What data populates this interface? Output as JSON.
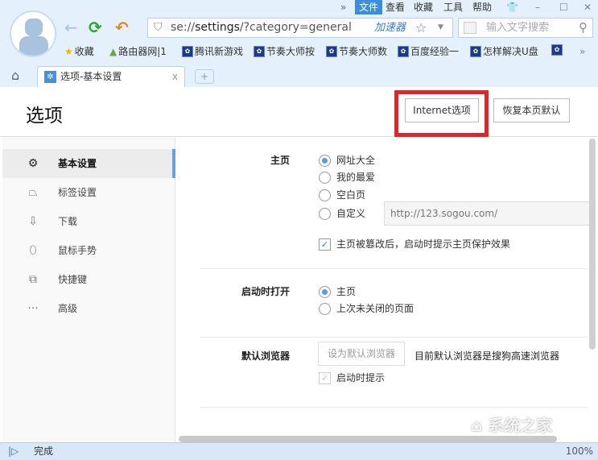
{
  "menubar": {
    "overflow": "»",
    "items": [
      "文件",
      "查看",
      "收藏",
      "工具",
      "帮助"
    ],
    "active": "文件"
  },
  "window_controls": {
    "skin": "👕",
    "minimize": "–",
    "maximize": "☐",
    "close": "✕"
  },
  "toolbar": {
    "back": "←",
    "refresh": "⟳",
    "undo": "↶",
    "address_prefix": "se://",
    "address_bold": "settings",
    "address_suffix": "/?category=general",
    "accelerator": "加速器",
    "search_placeholder": "输入文字搜索"
  },
  "bookmarks": [
    {
      "label": "收藏",
      "icon": "star-icon"
    },
    {
      "label": "路由器网|1",
      "icon": "router-icon"
    },
    {
      "label": "腾讯新游戏",
      "icon": "paw-icon"
    },
    {
      "label": "节奏大师按",
      "icon": "paw-icon"
    },
    {
      "label": "节奏大师数",
      "icon": "paw-icon"
    },
    {
      "label": "百度经验一",
      "icon": "paw-icon"
    },
    {
      "label": "怎样解决U盘",
      "icon": "paw-icon"
    },
    {
      "label": "",
      "icon": "paw-icon"
    }
  ],
  "bookmarks_overflow": "»",
  "tabs": [
    {
      "label": "选项-基本设置",
      "close": "x"
    }
  ],
  "new_tab": "+",
  "page": {
    "title": "选项",
    "internet_options": "Internet选项",
    "restore_defaults": "恢复本页默认"
  },
  "sidebar": {
    "items": [
      {
        "label": "基本设置",
        "icon": "gear-icon",
        "active": true
      },
      {
        "label": "标签设置",
        "icon": "tab-icon"
      },
      {
        "label": "下载",
        "icon": "download-icon"
      },
      {
        "label": "鼠标手势",
        "icon": "mouse-icon"
      },
      {
        "label": "快捷键",
        "icon": "shortcut-icon"
      },
      {
        "label": "高级",
        "icon": "more-icon"
      }
    ]
  },
  "homepage": {
    "label": "主页",
    "options": [
      "网址大全",
      "我的最爱",
      "空白页",
      "自定义"
    ],
    "selected": "网址大全",
    "custom_url": "http://123.sogou.com/",
    "protect_label": "主页被篡改后，启动时提示主页保护效果",
    "protect_checked": true
  },
  "startup": {
    "label": "启动时打开",
    "options": [
      "主页",
      "上次未关闭的页面"
    ],
    "selected": "主页"
  },
  "default_browser": {
    "label": "默认浏览器",
    "button": "设为默认浏览器",
    "status": "目前默认浏览器是搜狗高速浏览器",
    "prompt_label": "启动时提示",
    "prompt_checked": true
  },
  "statusbar": {
    "text": "完成",
    "zoom": "100%"
  },
  "watermark": "系统之家 XITONGZHIJIA",
  "colors": {
    "accent": "#3c8fd6",
    "highlight_box": "#e0262b"
  }
}
